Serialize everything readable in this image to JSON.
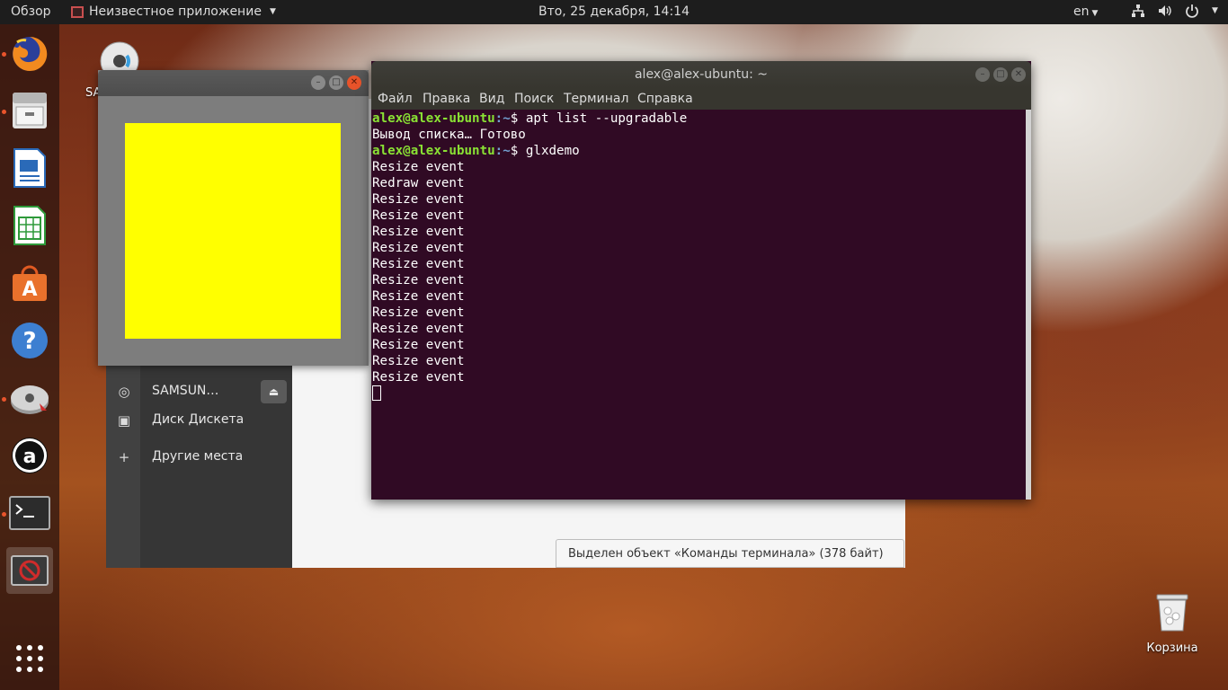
{
  "topbar": {
    "overview": "Обзор",
    "app_menu": "Неизвестное приложение",
    "clock": "Вто, 25 декабря, 14:14",
    "lang": "en"
  },
  "desktop": {
    "cd_label": "SA",
    "trash_label": "Корзина"
  },
  "dock": {
    "items": [
      "firefox-icon",
      "files-icon",
      "writer-icon",
      "calc-icon",
      "software-center-icon",
      "help-icon",
      "disc-icon",
      "amazon-icon",
      "terminal-icon",
      "blocked-app-icon",
      "show-apps-icon"
    ]
  },
  "file_manager": {
    "items": [
      {
        "label": "SAMSUN…",
        "icon": "disc-icon"
      },
      {
        "label": "Диск Дискета",
        "icon": "floppy-icon"
      },
      {
        "label": "Другие места",
        "icon": "plus-icon"
      }
    ],
    "status": "Выделен объект «Команды терминала»  (378 байт)"
  },
  "terminal": {
    "title": "alex@alex-ubuntu: ~",
    "menu": [
      "Файл",
      "Правка",
      "Вид",
      "Поиск",
      "Терминал",
      "Справка"
    ],
    "prompt_user": "alex@alex-ubuntu",
    "prompt_path": ":~",
    "prompt_symbol": "$",
    "cmd1": "apt list --upgradable",
    "out1": "Вывод списка… Готово",
    "cmd2": "glxdemo",
    "events": [
      "Resize event",
      "Redraw event",
      "Resize event",
      "Resize event",
      "Resize event",
      "Resize event",
      "Resize event",
      "Resize event",
      "Resize event",
      "Resize event",
      "Resize event",
      "Resize event",
      "Resize event",
      "Resize event"
    ]
  },
  "colors": {
    "terminal_bg": "#300a24",
    "glx_square": "#ffff00",
    "accent": "#e9542c"
  }
}
